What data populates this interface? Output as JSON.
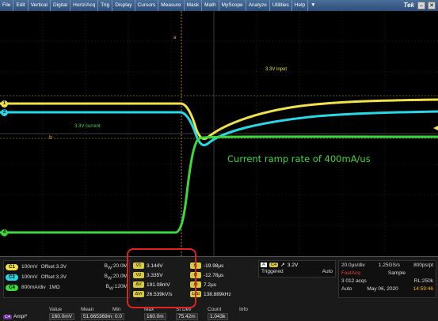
{
  "menu": [
    "File",
    "Edit",
    "Vertical",
    "Digital",
    "Horiz/Acq",
    "Trig",
    "Display",
    "Cursors",
    "Measure",
    "Mask",
    "Math",
    "MyScope",
    "Analyze",
    "Utilities",
    "Help"
  ],
  "menu_dropdown": "▼",
  "brand": "Tek",
  "window_buttons": [
    "–",
    "✕"
  ],
  "screen": {
    "label_input": "3.3V input",
    "label_current": "3.3V current",
    "annotation": "Current ramp rate of 400mA/us",
    "time_cursor_a": "a",
    "time_cursor_b": "b",
    "ch_markers": [
      {
        "label": "1",
        "color": "#f2e24a"
      },
      {
        "label": "2",
        "color": "#27d8e6"
      },
      {
        "label": "4",
        "color": "#3cd83c"
      }
    ],
    "colors": {
      "ch1": "#f2e24a",
      "ch2": "#27d8e6",
      "ch4": "#3cd83c",
      "cursor": "#f0a020"
    }
  },
  "channels": [
    {
      "tag": "C1",
      "color": "#f2e24a",
      "scale": "100mV",
      "offset": "Offset:3.3V",
      "bw": "B",
      "bw_val": "20.0M"
    },
    {
      "tag": "C2",
      "color": "#27d8e6",
      "scale": "100mV",
      "offset": "Offset:3.3V",
      "bw": "B",
      "bw_val": "20.0M"
    },
    {
      "tag": "C4",
      "color": "#3cd83c",
      "scale": "800mA/div",
      "offset": "1MΩ",
      "bw": "B",
      "bw_val": "120M"
    }
  ],
  "cursors_left": [
    {
      "tag": "V1",
      "value": "3.144V"
    },
    {
      "tag": "V2",
      "value": "3.335V"
    },
    {
      "tag": "ΔV",
      "value": "191.08mV"
    },
    {
      "tag": "ΔV/Δt",
      "value": "26.539kV/s"
    }
  ],
  "cursors_right": [
    {
      "tag": "t1",
      "value": "-19.98μs"
    },
    {
      "tag": "t2",
      "value": "-12.78μs"
    },
    {
      "tag": "Δt",
      "value": "7.2μs"
    },
    {
      "tag": "1/Δt",
      "value": "138.889kHz"
    }
  ],
  "trigger": {
    "mode": "A",
    "source": "C4",
    "slope": "↗",
    "level": "3.2V",
    "status": "Triggered",
    "auto": "Auto"
  },
  "acquisition": {
    "timebase": "20.0μs/div",
    "sample_rate": "1.25GS/s",
    "pts": "800ps/pt",
    "mode": "FastAcq",
    "sample": "Sample",
    "acqs": "3 012 acqs",
    "rl": "RL:250k",
    "auto": "Auto",
    "date": "May 06, 2020",
    "time": "14:59:46"
  },
  "measurement": {
    "headers": [
      "",
      "Value",
      "Mean",
      "Min",
      "Max",
      "St Dev",
      "Count",
      "Info"
    ],
    "rows": [
      {
        "tag": "C4",
        "name": "Ampl*",
        "value": "160.0mV",
        "mean": "51.665369m",
        "min": "0.0",
        "max": "160.0m",
        "stdev": "75.42m",
        "count": "1.043k",
        "info": ""
      }
    ]
  }
}
